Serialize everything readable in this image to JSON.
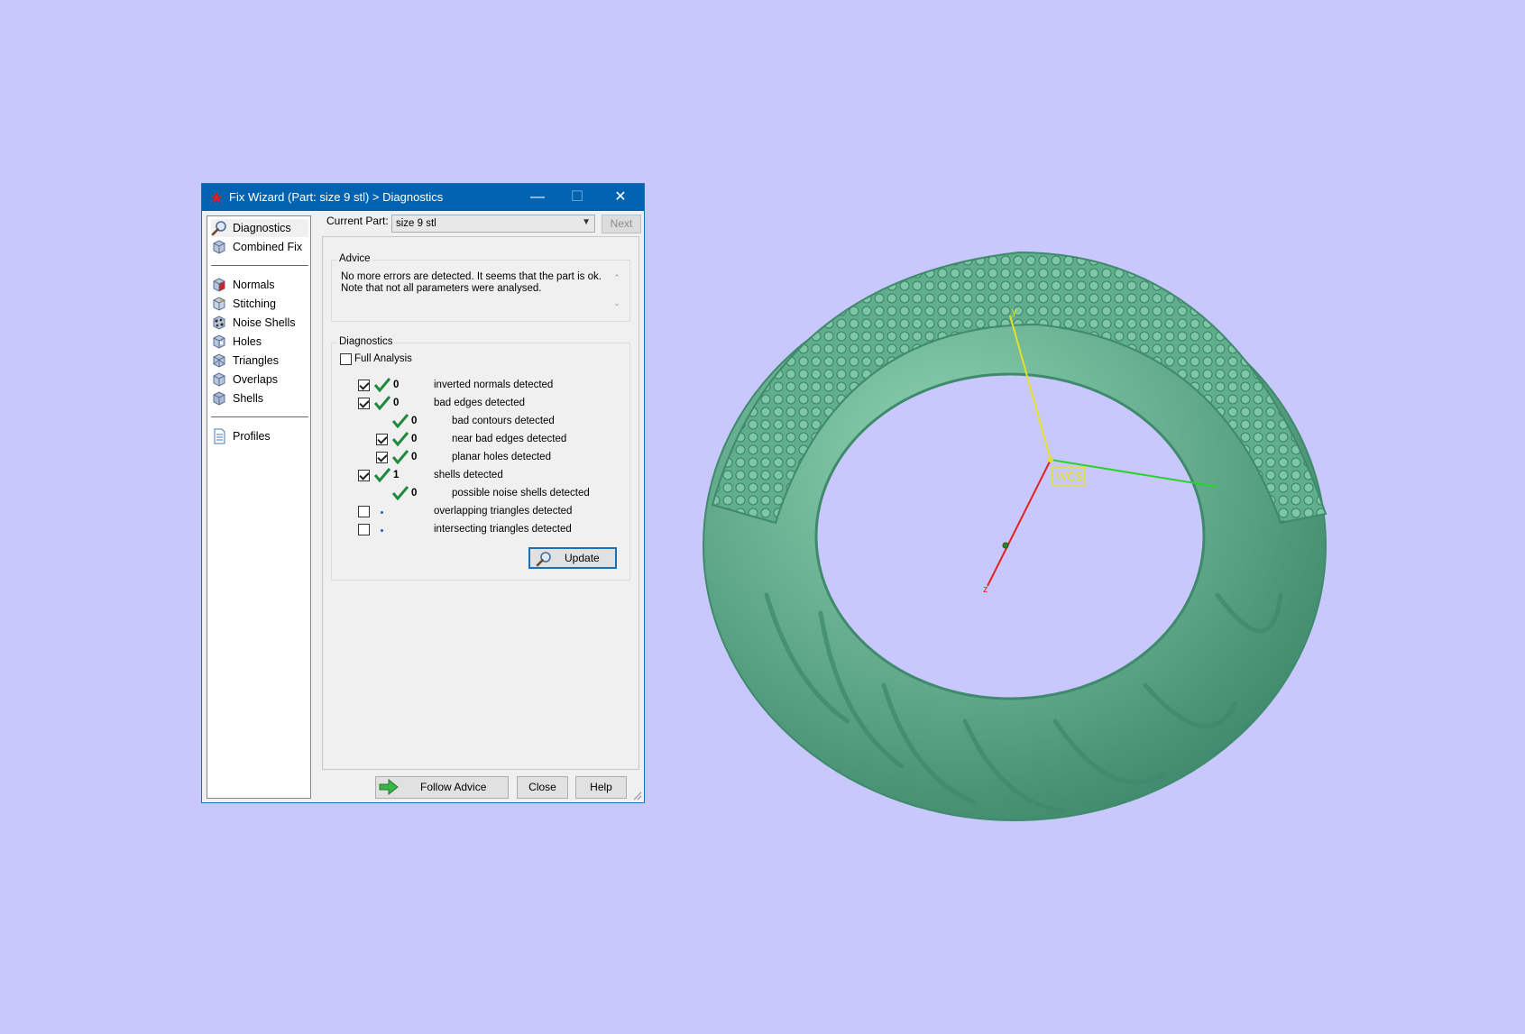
{
  "window": {
    "title": "Fix Wizard (Part: size 9 stl) > Diagnostics",
    "minimize": "—",
    "maximize": "☐",
    "close": "✕"
  },
  "nav": {
    "items": [
      {
        "label": "Diagnostics",
        "icon": "magnifier-icon"
      },
      {
        "label": "Combined Fix",
        "icon": "cube-icon"
      },
      {
        "label": "Normals",
        "icon": "normals-cube-icon"
      },
      {
        "label": "Stitching",
        "icon": "stitching-cube-icon"
      },
      {
        "label": "Noise Shells",
        "icon": "noise-shells-icon"
      },
      {
        "label": "Holes",
        "icon": "holes-cube-icon"
      },
      {
        "label": "Triangles",
        "icon": "triangles-cube-icon"
      },
      {
        "label": "Overlaps",
        "icon": "overlaps-cube-icon"
      },
      {
        "label": "Shells",
        "icon": "shells-cube-icon"
      },
      {
        "label": "Profiles",
        "icon": "profiles-document-icon"
      }
    ]
  },
  "current_part": {
    "label": "Current Part:",
    "value": "size 9 stl",
    "next_label": "Next"
  },
  "advice": {
    "title": "Advice",
    "text_line1": "No more errors are detected. It seems that the part is ok.",
    "text_line2": "Note that not all parameters were analysed."
  },
  "diagnostics": {
    "title": "Diagnostics",
    "full_analysis_label": "Full Analysis",
    "rows": [
      {
        "count": "0",
        "label": "inverted normals detected",
        "checked": true,
        "status": "ok"
      },
      {
        "count": "0",
        "label": "bad edges detected",
        "checked": true,
        "status": "ok"
      },
      {
        "count": "0",
        "label": "bad contours detected",
        "status": "ok"
      },
      {
        "count": "0",
        "label": "near bad edges detected",
        "checked": true,
        "status": "ok"
      },
      {
        "count": "0",
        "label": "planar holes detected",
        "checked": true,
        "status": "ok"
      },
      {
        "count": "1",
        "label": "shells detected",
        "checked": true,
        "status": "ok"
      },
      {
        "count": "0",
        "label": "possible noise shells detected",
        "status": "ok"
      },
      {
        "count": "",
        "label": "overlapping triangles detected",
        "checked": false,
        "status": "not-analysed"
      },
      {
        "count": "",
        "label": "intersecting triangles detected",
        "checked": false,
        "status": "not-analysed"
      }
    ],
    "update_label": "Update"
  },
  "footer": {
    "follow_advice_label": "Follow Advice",
    "close_label": "Close",
    "help_label": "Help"
  },
  "viewport": {
    "wcs_label": "WCS",
    "axis_y_label": "y",
    "axis_z_label": "z",
    "model_color": "#5fae8e",
    "background_color": "#c8c8fc"
  }
}
